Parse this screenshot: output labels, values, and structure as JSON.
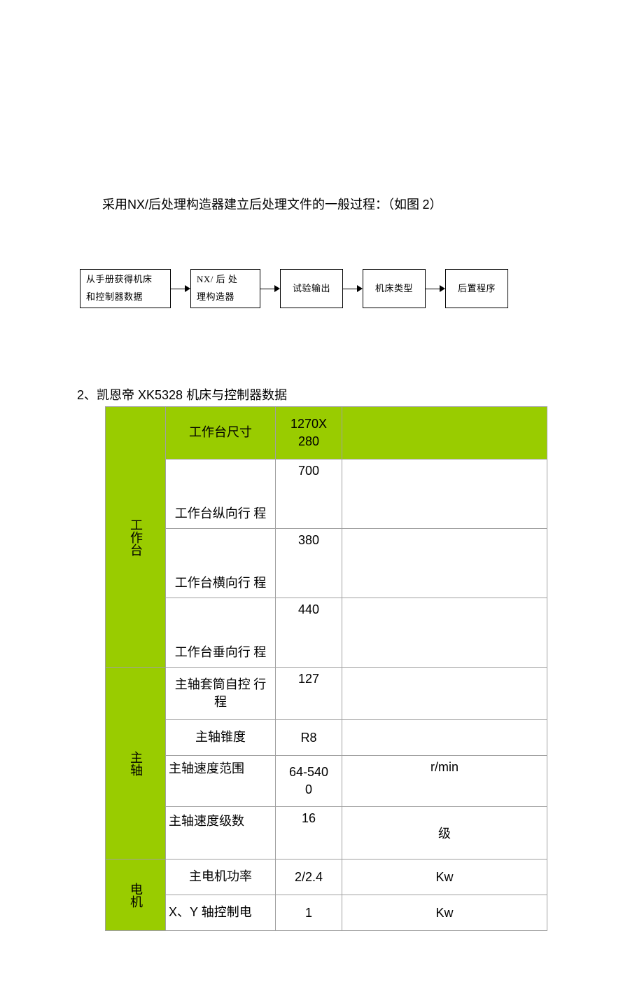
{
  "intro": {
    "prefix": "采用",
    "nx": "NX/",
    "rest": "后处理构造器建立后处理文件的一般过程：（如图 ",
    "num": "2",
    "close": "）"
  },
  "flow": {
    "box1_line1": "从手册获得机床",
    "box1_line2": "和控制器数据",
    "box2_line1": "NX/  后 处",
    "box2_line2": "理构造器",
    "box3": "试验输出",
    "box4": "机床类型",
    "box5": "后置程序"
  },
  "section2": {
    "num": "2",
    "sep": "、凯恩帝",
    "model": " XK5328 ",
    "rest": "机床与控制器数据"
  },
  "table": {
    "cat1": "工作台",
    "cat2": "主轴",
    "cat3": "电机",
    "r1_param": "工作台尺寸",
    "r1_val_l1": "1270X",
    "r1_val_l2": "280",
    "r2_param": "工作台纵向行  程",
    "r2_val": "700",
    "r3_param": "工作台横向行  程",
    "r3_val": "380",
    "r4_param": "工作台垂向行  程",
    "r4_val": "440",
    "r5_param_l1": "主轴套筒自控  行",
    "r5_param_l2": "程",
    "r5_val": "127",
    "r6_param": "主轴锥度",
    "r6_val": "R8",
    "r7_param": "主轴速度范围",
    "r7_val_l1": "64-540",
    "r7_val_l2": "0",
    "r7_unit": "r/min",
    "r8_param": "主轴速度级数",
    "r8_val": "16",
    "r8_unit": "级",
    "r9_param": "主电机功率",
    "r9_val": "2/2.4",
    "r9_unit": "Kw",
    "r10_param_a": "X",
    "r10_param_b": "、",
    "r10_param_c": "Y ",
    "r10_param_d": "轴控制电",
    "r10_val": "1",
    "r10_unit": "Kw"
  }
}
